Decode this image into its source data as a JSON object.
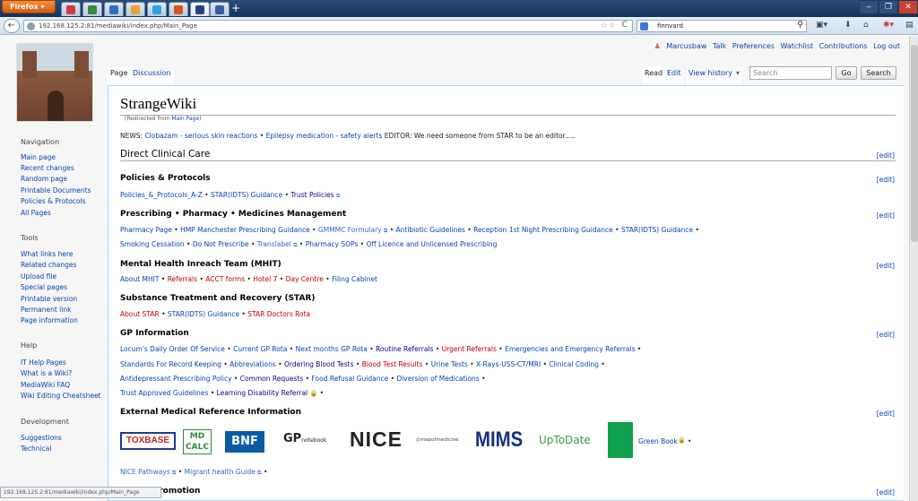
{
  "browser": {
    "app_button": "Firefox",
    "url": "192.168.125.2:81/mediawiki/index.php/Main_Page",
    "search_value": "finnvard",
    "colors": {
      "titlebar": "#13335a",
      "firefox_orange": "#e0731f"
    }
  },
  "personal": {
    "user": "Marcusbaw",
    "talk": "Talk",
    "preferences": "Preferences",
    "watchlist": "Watchlist",
    "contributions": "Contributions",
    "logout": "Log out"
  },
  "tabs": {
    "page": "Page",
    "discussion": "Discussion",
    "read": "Read",
    "edit": "Edit",
    "history": "View history",
    "search_placeholder": "Search",
    "go": "Go",
    "search": "Search"
  },
  "sidebar": {
    "navigation": {
      "heading": "Navigation",
      "items": [
        "Main page",
        "Recent changes",
        "Random page",
        "Printable Documents",
        "Policies & Protocols",
        "All Pages"
      ]
    },
    "tools": {
      "heading": "Tools",
      "items": [
        "What links here",
        "Related changes",
        "Upload file",
        "Special pages",
        "Printable version",
        "Permanent link",
        "Page information"
      ]
    },
    "help": {
      "heading": "Help",
      "items": [
        "IT Help Pages",
        "What is a Wiki?",
        "MediaWiki FAQ",
        "Wiki Editing Cheatsheet"
      ]
    },
    "development": {
      "heading": "Development",
      "items": [
        "Suggestions",
        "Technical"
      ]
    }
  },
  "content": {
    "title": "StrangeWiki",
    "redirected_prefix": "(Redirected from ",
    "redirected_link": "Main Page",
    "redirected_suffix": ")",
    "news_prefix": "NEWS: ",
    "news_link1": "Clobazam - serious skin reactions",
    "news_link2": "Epilepsy medication - safety alerts",
    "news_suffix": " EDITOR: We need someone from STAR to be an editor.....",
    "edit_label": "[edit]",
    "sections": {
      "direct_care": "Direct Clinical Care",
      "policies": {
        "title": "Policies & Protocols",
        "links": [
          "Policies_&_Protocols_A-Z",
          "STAR(IDTS) Guidance",
          "Trust Policies"
        ]
      },
      "prescribing": {
        "title": "Prescribing • Pharmacy • Medicines Management",
        "line1": [
          "Pharmacy Page",
          "HMP Manchester Prescribing Guidance",
          "GMMMC Formulary",
          "Antibiotic Guidelines",
          "Reception 1st Night Prescribing Guidance",
          "STAR(IDTS) Guidance"
        ],
        "line2": [
          "Smoking Cessation",
          "Do Not Prescribe",
          "Translabel",
          "Pharmacy SOPs",
          "Off Licence and Unlicensed Prescribing"
        ]
      },
      "mhit": {
        "title": "Mental Health Inreach Team (MHIT)",
        "links": [
          "About MHIT",
          "Referrals",
          "ACCT forms",
          "Hotel 7",
          "Day Centre",
          "Filing Cabinet"
        ]
      },
      "star": {
        "title": "Substance Treatment and Recovery (STAR)",
        "links": [
          "About STAR",
          "STAR(IDTS) Guidance",
          "STAR Doctors Rota"
        ]
      },
      "gp": {
        "title": "GP Information",
        "line1": [
          "Locum's Daily Order Of Service",
          "Current GP Rota",
          "Next months GP Rota",
          "Routine Referrals",
          "Urgent Referrals",
          "Emergencies and Emergency Referrals"
        ],
        "line2": [
          "Standards For Record Keeping",
          "Abbreviations",
          "Ordering Blood Tests",
          "Blood Test Results",
          "Urine Tests",
          "X-Rays-USS-CT/MRI",
          "Clinical Coding"
        ],
        "line3": [
          "Antidepressant Prescribing Policy",
          "Common Requests",
          "Food Refusal Guidance",
          "Diversion of Medications"
        ],
        "line4": [
          "Trust Approved Guidelines",
          "Learning Disability Referral"
        ]
      },
      "external": {
        "title": "External Medical Reference Information",
        "logos": {
          "toxbase": "TOXBASE",
          "mdcalc_top": "MD",
          "mdcalc_bottom": "CALC",
          "bnf": "BNF",
          "gpnotebook_big": "GP",
          "gpnotebook_small": "notebook",
          "nice": "NICE",
          "mapofmedicine": "mapofmedicine",
          "mims": "MIMS",
          "uptodate": "UpToDate",
          "greenbook": "Green Book"
        },
        "links_line": [
          "NICE Pathways",
          "Migrant health Guide"
        ]
      },
      "health_promotion": "Health Promotion"
    }
  },
  "status_url": "192.168.125.2:81/mediawiki/index.php/Main_Page"
}
